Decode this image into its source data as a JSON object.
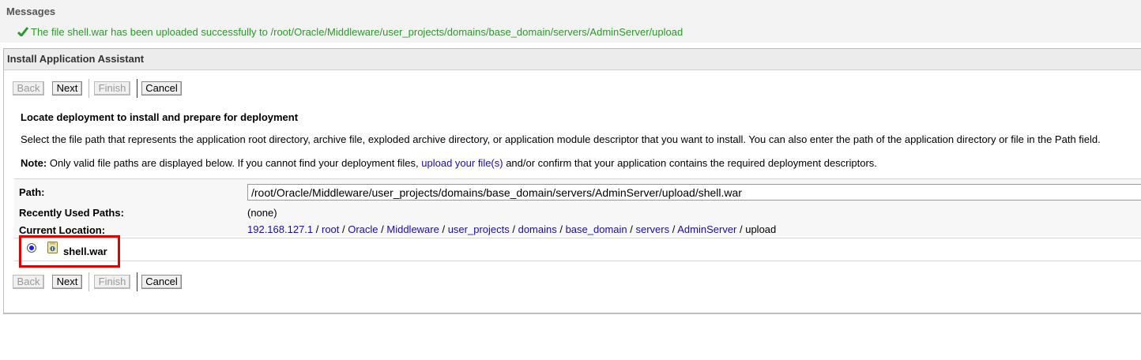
{
  "messages": {
    "title": "Messages",
    "success_text": "The file shell.war has been uploaded successfully to /root/Oracle/Middleware/user_projects/domains/base_domain/servers/AdminServer/upload",
    "icon": "check-icon",
    "color": "#2a9a2a"
  },
  "assistant": {
    "title": "Install Application Assistant",
    "buttons": {
      "back": "Back",
      "next": "Next",
      "finish": "Finish",
      "cancel": "Cancel"
    },
    "heading": "Locate deployment to install and prepare for deployment",
    "description": "Select the file path that represents the application root directory, archive file, exploded archive directory, or application module descriptor that you want to install. You can also enter the path of the application directory or file in the Path field.",
    "note_label": "Note:",
    "note_pre": " Only valid file paths are displayed below. If you cannot find your deployment files, ",
    "note_link": "upload your file(s)",
    "note_post": " and/or confirm that your application contains the required deployment descriptors.",
    "path_label": "Path:",
    "path_value": "/root/Oracle/Middleware/user_projects/domains/base_domain/servers/AdminServer/upload/shell.war",
    "recent_label": "Recently Used Paths:",
    "recent_value": "(none)",
    "location_label": "Current Location:",
    "location": [
      {
        "text": "192.168.127.1",
        "link": true
      },
      {
        "text": "root",
        "link": true
      },
      {
        "text": "Oracle",
        "link": true
      },
      {
        "text": "Middleware",
        "link": true
      },
      {
        "text": "user_projects",
        "link": true
      },
      {
        "text": "domains",
        "link": true
      },
      {
        "text": "base_domain",
        "link": true
      },
      {
        "text": "servers",
        "link": true
      },
      {
        "text": "AdminServer",
        "link": true
      },
      {
        "text": "upload",
        "link": false
      }
    ],
    "separator": " / ",
    "file": {
      "name": "shell.war",
      "icon": "war-archive-icon",
      "selected": true
    }
  }
}
